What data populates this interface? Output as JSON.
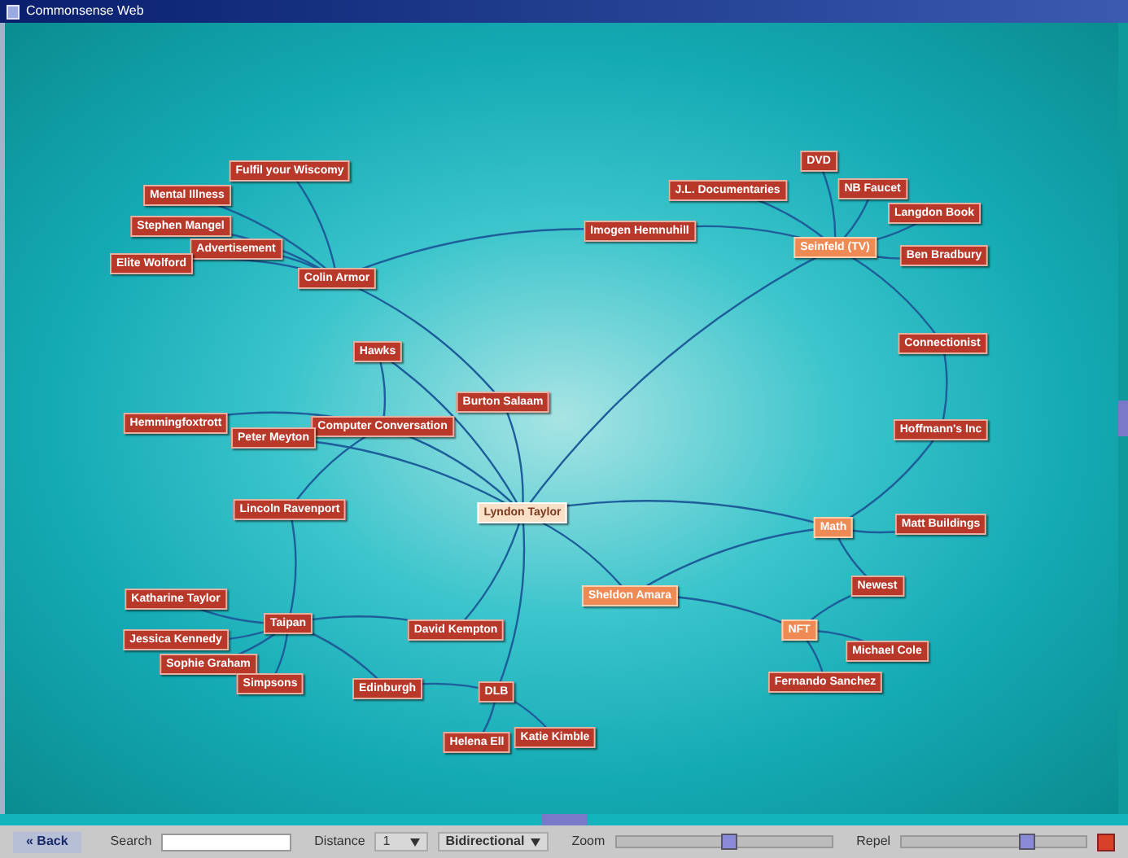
{
  "window": {
    "title": "Commonsense Web"
  },
  "graph": {
    "nodes": [
      {
        "label": "Fulfil your Wiscomy",
        "kind": "node"
      },
      {
        "label": "Mental Illness",
        "kind": "node"
      },
      {
        "label": "Stephen Mangel",
        "kind": "node"
      },
      {
        "label": "Advertisement",
        "kind": "node"
      },
      {
        "label": "Elite Wolford",
        "kind": "node"
      },
      {
        "label": "Colin Armor",
        "kind": "node"
      },
      {
        "label": "Hawks",
        "kind": "node"
      },
      {
        "label": "Burton Salaam",
        "kind": "node"
      },
      {
        "label": "Hemmingfoxtrott",
        "kind": "node"
      },
      {
        "label": "Computer Conversation",
        "kind": "node"
      },
      {
        "label": "Peter Meyton",
        "kind": "node"
      },
      {
        "label": "Lincoln Ravenport",
        "kind": "node"
      },
      {
        "label": "Lyndon Taylor",
        "kind": "focus"
      },
      {
        "label": "Katharine Taylor",
        "kind": "node"
      },
      {
        "label": "Taipan",
        "kind": "node"
      },
      {
        "label": "Jessica Kennedy",
        "kind": "node"
      },
      {
        "label": "Sophie Graham",
        "kind": "node"
      },
      {
        "label": "Simpsons",
        "kind": "node"
      },
      {
        "label": "David Kempton",
        "kind": "node"
      },
      {
        "label": "Edinburgh",
        "kind": "node"
      },
      {
        "label": "DLB",
        "kind": "node"
      },
      {
        "label": "Helena Ell",
        "kind": "node"
      },
      {
        "label": "Katie Kimble",
        "kind": "node"
      },
      {
        "label": "Sheldon Amara",
        "kind": "highlight"
      },
      {
        "label": "DVD",
        "kind": "node"
      },
      {
        "label": "J.L. Documentaries",
        "kind": "node"
      },
      {
        "label": "NB Faucet",
        "kind": "node"
      },
      {
        "label": "Langdon Book",
        "kind": "node"
      },
      {
        "label": "Imogen Hemnuhill",
        "kind": "node"
      },
      {
        "label": "Seinfeld (TV)",
        "kind": "highlight"
      },
      {
        "label": "Ben Bradbury",
        "kind": "node"
      },
      {
        "label": "Connectionist",
        "kind": "node"
      },
      {
        "label": "Hoffmann's Inc",
        "kind": "node"
      },
      {
        "label": "Math",
        "kind": "highlight"
      },
      {
        "label": "Matt Buildings",
        "kind": "node"
      },
      {
        "label": "Newest",
        "kind": "node"
      },
      {
        "label": "NFT",
        "kind": "highlight"
      },
      {
        "label": "Michael Cole",
        "kind": "node"
      },
      {
        "label": "Fernando Sanchez",
        "kind": "node"
      }
    ]
  },
  "toolbar": {
    "back": "« Back",
    "search_label": "Search",
    "distance_label": "Distance",
    "distance_value": "1",
    "direction": "Bidirectional",
    "zoom_label": "Zoom",
    "zoom": {
      "level": 0.52
    },
    "repel_label": "Repel",
    "repel": {
      "level": 0.68
    }
  }
}
